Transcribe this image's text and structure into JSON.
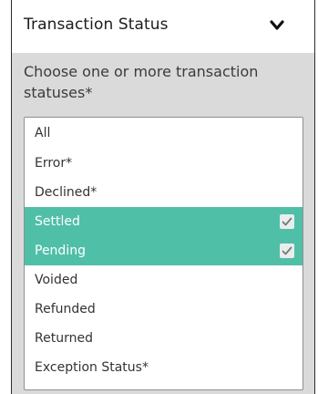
{
  "panel": {
    "title": "Transaction Status",
    "prompt": "Choose one or more transaction statuses*"
  },
  "options": [
    {
      "label": "All",
      "selected": false
    },
    {
      "label": "Error*",
      "selected": false
    },
    {
      "label": "Declined*",
      "selected": false
    },
    {
      "label": "Settled",
      "selected": true
    },
    {
      "label": "Pending",
      "selected": true
    },
    {
      "label": "Voided",
      "selected": false
    },
    {
      "label": "Refunded",
      "selected": false
    },
    {
      "label": "Returned",
      "selected": false
    },
    {
      "label": "Exception Status*",
      "selected": false
    }
  ],
  "colors": {
    "selected_bg": "#50bfa8",
    "panel_bg": "#dadada"
  },
  "icons": {
    "collapse": "chevron-down-icon",
    "checked": "checkbox-checked-icon"
  }
}
